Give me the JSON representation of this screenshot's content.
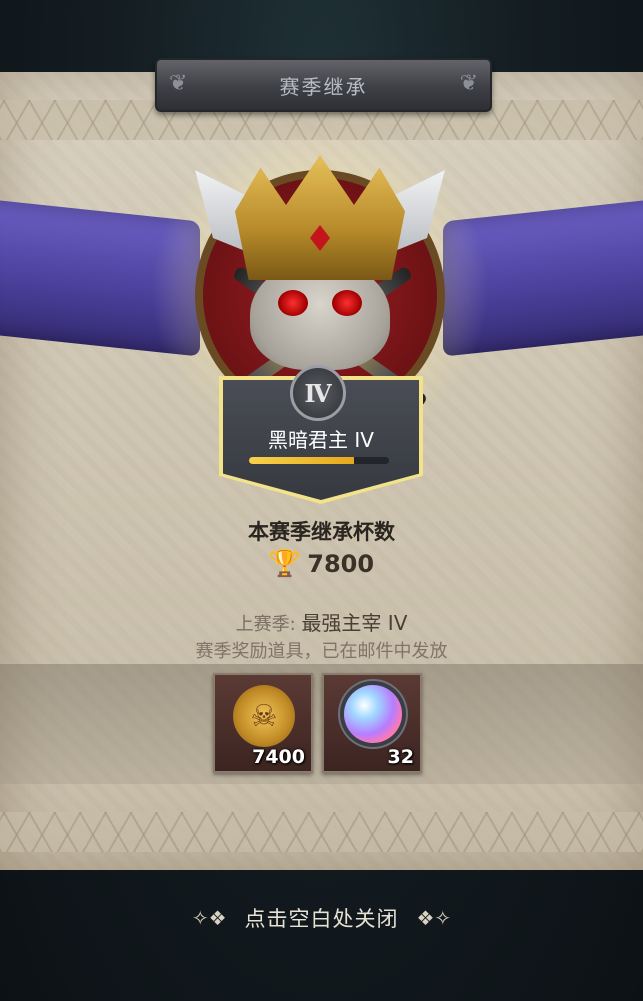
{
  "dialog": {
    "title": "赛季继承"
  },
  "rank": {
    "numeral": "Ⅳ",
    "name": "黑暗君主 IV",
    "progress": 0.75
  },
  "inherit": {
    "label": "本赛季继承杯数",
    "trophy_value": "7800"
  },
  "last_season": {
    "label": "上赛季:",
    "rank": "最强主宰 IV"
  },
  "reward_note": "赛季奖励道具，已在邮件中发放",
  "rewards": [
    {
      "icon": "skull-coin-icon",
      "count": "7400"
    },
    {
      "icon": "orb-gem-icon",
      "count": "32"
    }
  ],
  "close_hint": "点击空白处关闭",
  "colors": {
    "banner": "#4a3f99",
    "progress": "#f7d24a",
    "glow": "#f2e28a"
  }
}
